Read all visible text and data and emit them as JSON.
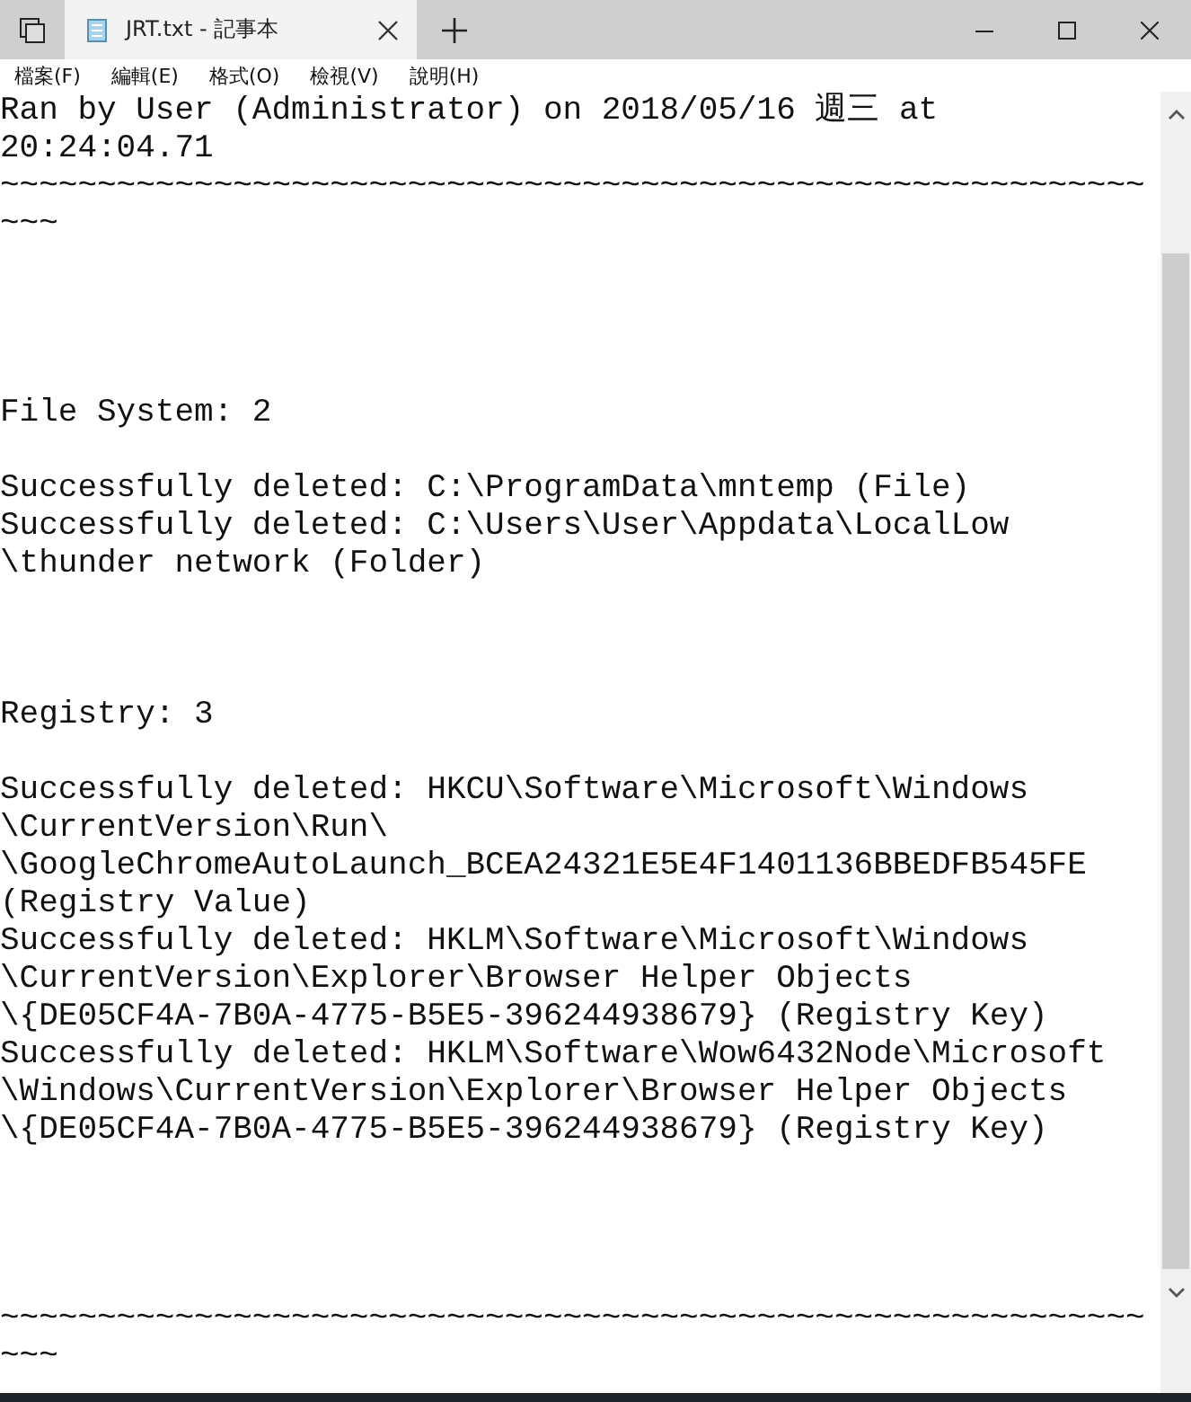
{
  "tab": {
    "title": "JRT.txt - 記事本",
    "selected": true
  },
  "menu": [
    "檔案(F)",
    "編輯(E)",
    "格式(O)",
    "檢視(V)",
    "說明(H)"
  ],
  "lines": [
    {
      "kind": "line",
      "text": "Ran by User (Administrator) on 2018/05/16 週三 at"
    },
    {
      "kind": "line",
      "text": "20:24:04.71"
    },
    {
      "kind": "line",
      "text": "~~~~~~~~~~~~~~~~~~~~~~~~~~~~~~~~~~~~~~~~~~~~~~~~~~~~~~~~~~~"
    },
    {
      "kind": "line",
      "text": "~~~"
    },
    {
      "kind": "blank"
    },
    {
      "kind": "blank"
    },
    {
      "kind": "blank"
    },
    {
      "kind": "blank"
    },
    {
      "kind": "line",
      "text": "File System: 2"
    },
    {
      "kind": "blank"
    },
    {
      "kind": "line",
      "text": "Successfully deleted: C:\\ProgramData\\mntemp (File)"
    },
    {
      "kind": "line",
      "text": "Successfully deleted: C:\\Users\\User\\Appdata\\LocalLow"
    },
    {
      "kind": "line",
      "text": "\\thunder network (Folder)"
    },
    {
      "kind": "blank"
    },
    {
      "kind": "blank"
    },
    {
      "kind": "blank"
    },
    {
      "kind": "line",
      "text": "Registry: 3"
    },
    {
      "kind": "blank"
    },
    {
      "kind": "line",
      "text": "Successfully deleted: HKCU\\Software\\Microsoft\\Windows"
    },
    {
      "kind": "line",
      "text": "\\CurrentVersion\\Run\\"
    },
    {
      "kind": "line",
      "text": "\\GoogleChromeAutoLaunch_BCEA24321E5E4F1401136BBEDFB545FE"
    },
    {
      "kind": "line",
      "text": "(Registry Value)"
    },
    {
      "kind": "line",
      "text": "Successfully deleted: HKLM\\Software\\Microsoft\\Windows"
    },
    {
      "kind": "line",
      "text": "\\CurrentVersion\\Explorer\\Browser Helper Objects"
    },
    {
      "kind": "line",
      "text": "\\{DE05CF4A-7B0A-4775-B5E5-396244938679} (Registry Key)"
    },
    {
      "kind": "line",
      "text": "Successfully deleted: HKLM\\Software\\Wow6432Node\\Microsoft"
    },
    {
      "kind": "line",
      "text": "\\Windows\\CurrentVersion\\Explorer\\Browser Helper Objects"
    },
    {
      "kind": "line",
      "text": "\\{DE05CF4A-7B0A-4775-B5E5-396244938679} (Registry Key)"
    },
    {
      "kind": "blank"
    },
    {
      "kind": "blank"
    },
    {
      "kind": "blank"
    },
    {
      "kind": "blank"
    },
    {
      "kind": "line",
      "text": "~~~~~~~~~~~~~~~~~~~~~~~~~~~~~~~~~~~~~~~~~~~~~~~~~~~~~~~~~~~"
    },
    {
      "kind": "line",
      "text": "~~~"
    }
  ]
}
